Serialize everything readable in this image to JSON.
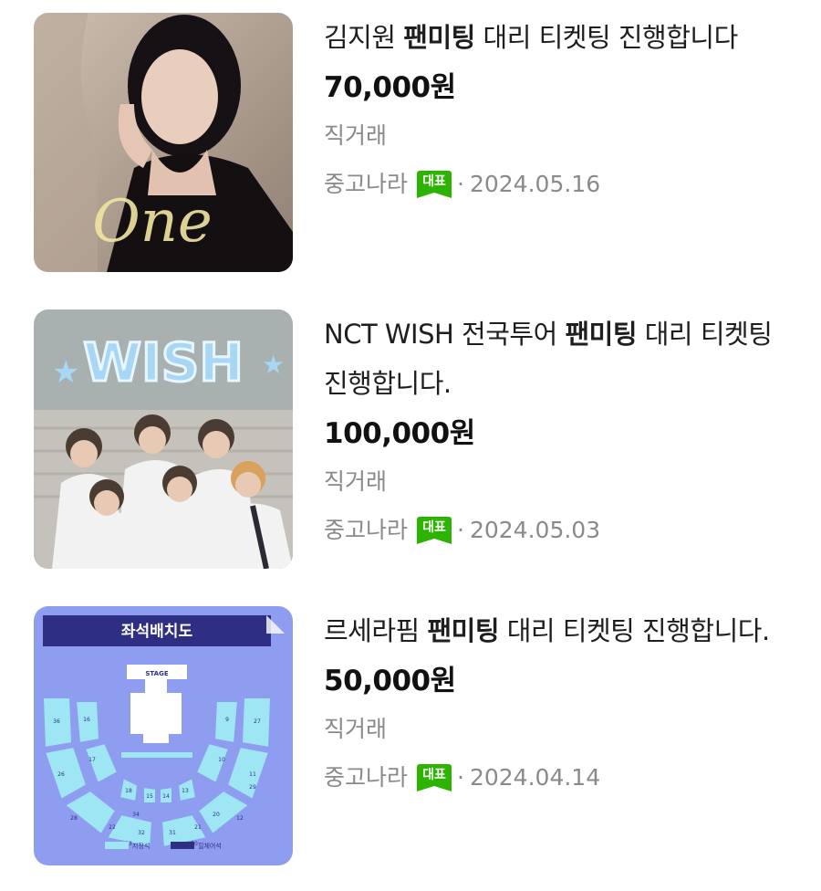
{
  "listings": [
    {
      "title_pre": "김지원 ",
      "title_bold": "팬미팅",
      "title_post": " 대리 티켓팅 진행합니다",
      "price": "70,000원",
      "deal": "직거래",
      "source": "중고나라",
      "badge": "대표",
      "date": "2024.05.16",
      "thumb_text": "One"
    },
    {
      "title_pre": "NCT WISH 전국투어 ",
      "title_bold": "팬미팅",
      "title_post": " 대리 티켓팅 진행합니다.",
      "price": "100,000원",
      "deal": "직거래",
      "source": "중고나라",
      "badge": "대표",
      "date": "2024.05.03",
      "thumb_text": "WISH"
    },
    {
      "title_pre": "르세라핌 ",
      "title_bold": "팬미팅",
      "title_post": " 대리 티켓팅 진행합니다.",
      "price": "50,000원",
      "deal": "직거래",
      "source": "중고나라",
      "badge": "대표",
      "date": "2024.04.14",
      "thumb_text": "좌석배치도",
      "thumb_stage": "STAGE",
      "thumb_legend": [
        "지정석",
        "힐체어석"
      ],
      "seat_labels": [
        "36",
        "16",
        "9",
        "27",
        "17",
        "10",
        "26",
        "18",
        "11",
        "28",
        "15",
        "14",
        "13",
        "12",
        "34",
        "22",
        "21",
        "20",
        "29",
        "33",
        "32",
        "31",
        "30"
      ]
    }
  ]
}
